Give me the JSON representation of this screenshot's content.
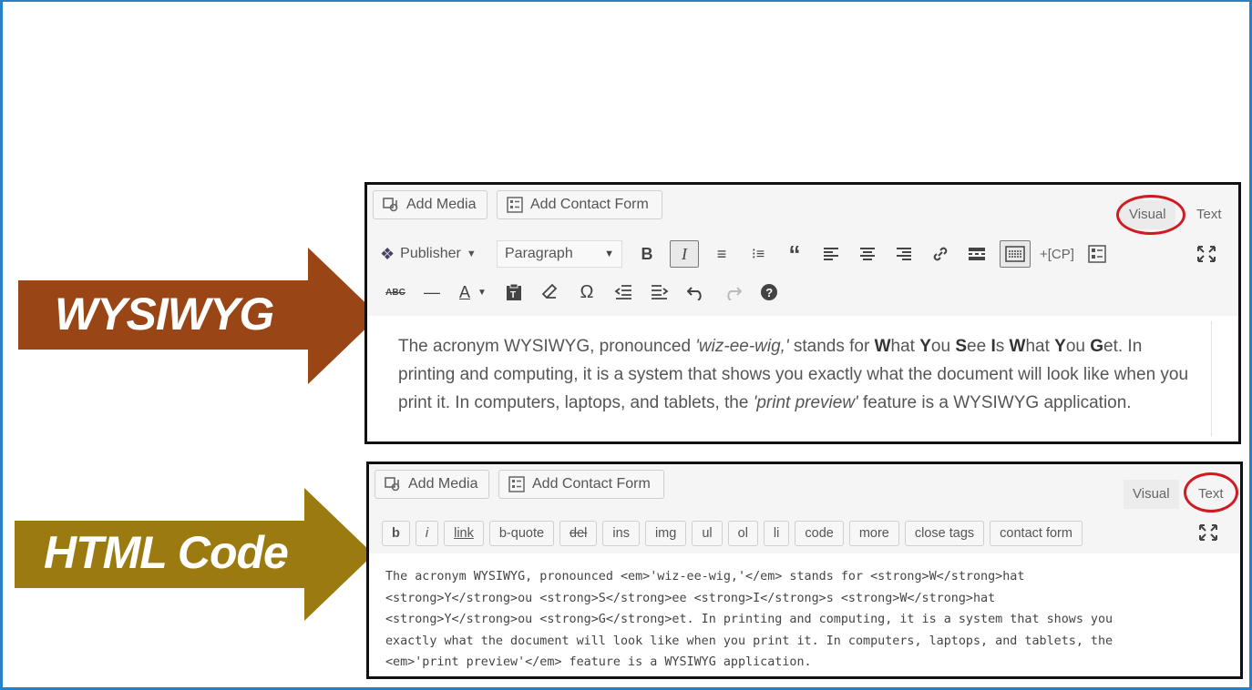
{
  "arrows": {
    "wysiwyg": {
      "label": "WYSIWYG",
      "color": "#9a4515"
    },
    "html": {
      "label": "HTML Code",
      "color": "#9b7a10"
    }
  },
  "top_editor": {
    "add_media": "Add Media",
    "add_contact_form": "Add Contact Form",
    "tab_visual": "Visual",
    "tab_text": "Text",
    "toolbar": {
      "publisher": "Publisher",
      "paragraph": "Paragraph",
      "cp": "+[CP]"
    },
    "content": {
      "p1": "The acronym WYSIWYG, pronounced ",
      "em1": "'wiz-ee-wig,'",
      "p2": " stands for ",
      "w": "W",
      "hat": "hat ",
      "y": "Y",
      "ou": "ou ",
      "s": "S",
      "ee": "ee ",
      "i": "I",
      "s2": "s ",
      "w2": "W",
      "hat2": "hat ",
      "y2": "Y",
      "ou2": "ou ",
      "g": "G",
      "p3": "et. In printing and computing, it is a system that shows you exactly what the document will look like when you print it. In computers, laptops, and tablets, the ",
      "em2": "'print preview'",
      "p4": " feature is a WYSIWYG application."
    }
  },
  "bottom_editor": {
    "add_media": "Add Media",
    "add_contact_form": "Add Contact Form",
    "tab_visual": "Visual",
    "tab_text": "Text",
    "quicktags": [
      "b",
      "i",
      "link",
      "b-quote",
      "del",
      "ins",
      "img",
      "ul",
      "ol",
      "li",
      "code",
      "more",
      "close tags",
      "contact form"
    ],
    "code": "The acronym WYSIWYG, pronounced <em>'wiz-ee-wig,'</em> stands for <strong>W</strong>hat\n<strong>Y</strong>ou <strong>S</strong>ee <strong>I</strong>s <strong>W</strong>hat\n<strong>Y</strong>ou <strong>G</strong>et. In printing and computing, it is a system that shows you\nexactly what the document will look like when you print it. In computers, laptops, and tablets, the\n<em>'print preview'</em> feature is a WYSIWYG application."
  },
  "colors": {
    "highlight_oval": "#d01b22",
    "frame": "#2b7fc4"
  }
}
